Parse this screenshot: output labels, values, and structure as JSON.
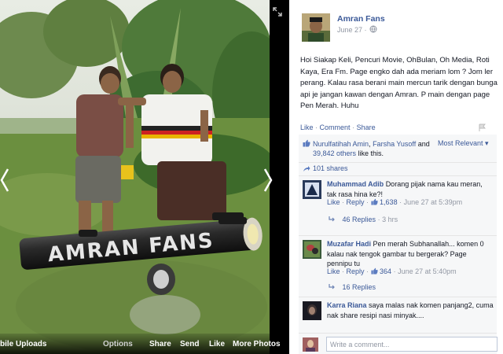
{
  "photo_viewer": {
    "bottom_bar": {
      "album": "bile Uploads",
      "options": "Options",
      "share": "Share",
      "send": "Send",
      "like": "Like",
      "more_photos": "More Photos"
    },
    "photo_text": "AMRAN FANS"
  },
  "post": {
    "page_name": "Amran Fans",
    "date": "June 27 · ",
    "text": "Hoi Siakap Keli, Pencuri Movie, OhBulan, Oh Media, Roti Kaya, Era Fm. Page engko dah ada meriam lom ? Jom ler perang. Kalau rasa berani main mercun tarik dengan bunga api je jangan kawan dengan Amran. P main dengan page Pen Merah. Huhu",
    "actions": {
      "like": "Like",
      "comment": "Comment",
      "share": "Share"
    },
    "likes": {
      "name1": "Nurulfatihah Amin",
      "comma": ", ",
      "name2": "Farsha Yusoff",
      "and": " and ",
      "others": "39,842 others",
      "suffix": " like this."
    },
    "sort": "Most Relevant ▾",
    "shares": "101 shares"
  },
  "comments": [
    {
      "name": "Muhammad Adib",
      "text": "Dorang pijak nama kau meran, tak rasa hina ke?!",
      "like": "Like",
      "reply": "Reply",
      "likes_count": "1,638",
      "time": "June 27 at 5:39pm",
      "replies": "46 Replies",
      "replies_time": "3 hrs"
    },
    {
      "name": "Muzafar Hadi",
      "text": "Pen merah Subhanallah... komen 0 kalau nak tengok gambar tu bergerak? Page pennipu tu",
      "like": "Like",
      "reply": "Reply",
      "likes_count": "364",
      "time": "June 27 at 5:40pm",
      "replies": "16 Replies"
    },
    {
      "name": "Karra Riana",
      "text": "saya malas nak komen panjang2, cuma nak share resipi nasi minyak...."
    }
  ],
  "comment_box": {
    "placeholder": "Write a comment..."
  },
  "colors": {
    "link": "#3b5998",
    "meta": "#9197a3",
    "ufi_bg": "#f6f7f8"
  }
}
